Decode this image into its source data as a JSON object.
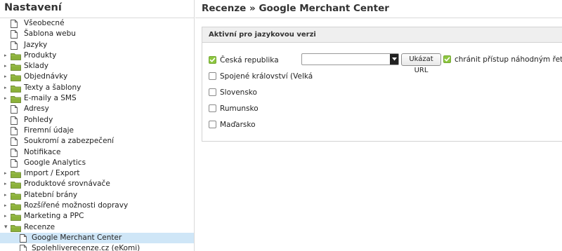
{
  "sidebar": {
    "title": "Nastavení",
    "items": [
      {
        "label": "Všeobecné",
        "type": "doc",
        "level": 0,
        "expanded": null,
        "selected": false
      },
      {
        "label": "Šablona webu",
        "type": "doc",
        "level": 0,
        "expanded": null,
        "selected": false
      },
      {
        "label": "Jazyky",
        "type": "doc",
        "level": 0,
        "expanded": null,
        "selected": false
      },
      {
        "label": "Produkty",
        "type": "folder",
        "level": 0,
        "expanded": false,
        "selected": false
      },
      {
        "label": "Sklady",
        "type": "folder",
        "level": 0,
        "expanded": false,
        "selected": false
      },
      {
        "label": "Objednávky",
        "type": "folder",
        "level": 0,
        "expanded": false,
        "selected": false
      },
      {
        "label": "Texty a šablony",
        "type": "folder",
        "level": 0,
        "expanded": false,
        "selected": false
      },
      {
        "label": "E-maily a SMS",
        "type": "folder",
        "level": 0,
        "expanded": false,
        "selected": false
      },
      {
        "label": "Adresy",
        "type": "doc",
        "level": 0,
        "expanded": null,
        "selected": false
      },
      {
        "label": "Pohledy",
        "type": "doc",
        "level": 0,
        "expanded": null,
        "selected": false
      },
      {
        "label": "Firemní údaje",
        "type": "doc",
        "level": 0,
        "expanded": null,
        "selected": false
      },
      {
        "label": "Soukromí a zabezpečení",
        "type": "doc",
        "level": 0,
        "expanded": null,
        "selected": false
      },
      {
        "label": "Notifikace",
        "type": "doc",
        "level": 0,
        "expanded": null,
        "selected": false
      },
      {
        "label": "Google Analytics",
        "type": "doc",
        "level": 0,
        "expanded": null,
        "selected": false
      },
      {
        "label": "Import / Export",
        "type": "folder",
        "level": 0,
        "expanded": false,
        "selected": false
      },
      {
        "label": "Produktové srovnávače",
        "type": "folder",
        "level": 0,
        "expanded": false,
        "selected": false
      },
      {
        "label": "Platební brány",
        "type": "folder",
        "level": 0,
        "expanded": false,
        "selected": false
      },
      {
        "label": "Rozšířené možnosti dopravy",
        "type": "folder",
        "level": 0,
        "expanded": false,
        "selected": false
      },
      {
        "label": "Marketing a PPC",
        "type": "folder",
        "level": 0,
        "expanded": false,
        "selected": false
      },
      {
        "label": "Recenze",
        "type": "folder",
        "level": 0,
        "expanded": true,
        "selected": false
      },
      {
        "label": "Google Merchant Center",
        "type": "doc",
        "level": 1,
        "expanded": null,
        "selected": true
      },
      {
        "label": "Spolehliverecenze.cz (eKomi)",
        "type": "doc",
        "level": 1,
        "expanded": null,
        "selected": false
      }
    ]
  },
  "main": {
    "title": "Recenze » Google Merchant Center",
    "panel": {
      "header": "Aktivní pro jazykovou verzi",
      "countries": [
        {
          "label": "Česká republika",
          "checked": true
        },
        {
          "label": "Spojené království (Velká",
          "checked": false
        },
        {
          "label": "Slovensko",
          "checked": false
        },
        {
          "label": "Rumunsko",
          "checked": false
        },
        {
          "label": "Maďarsko",
          "checked": false
        }
      ],
      "url_select_value": "",
      "show_url_label": "Ukázat URL",
      "protect_label": "chránit přístup náhodným řetězcem",
      "protect_checked": true
    }
  },
  "colors": {
    "accent_green": "#8dc63f",
    "selected_bg": "#cfe6f7",
    "folder_green": "#8bb13a"
  },
  "icons": {
    "doc": "document-icon",
    "folder": "folder-icon",
    "collapsed": "triangle-right-icon",
    "expanded": "triangle-down-icon",
    "check": "checkmark-icon",
    "dropdown": "chevron-down-icon"
  }
}
